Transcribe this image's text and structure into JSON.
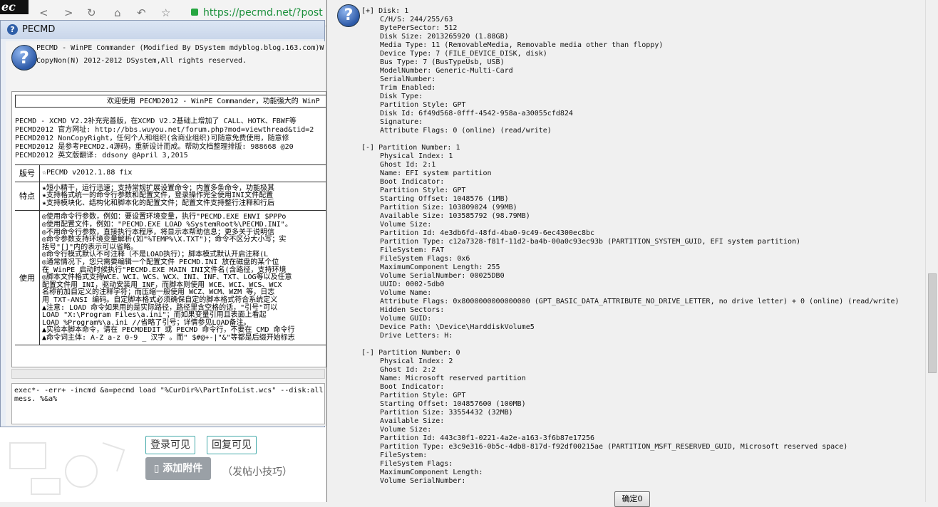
{
  "browser": {
    "url": "https://pecmd.net/?post",
    "logo_text": "ec"
  },
  "pecmd": {
    "title": "PECMD",
    "header_line1": "PECMD - WinPE Commander (Modified By DSystem mdyblog.blog.163.com)W",
    "header_line2": "CopyNon(N) 2012-2012 DSystem,All rights reserved.",
    "banner": "欢迎使用 PECMD2012 - WinPE Commander，功能强大的 WinP",
    "intro_lines": [
      "PECMD - XCMD V2.2补充完善版，在XCMD V2.2基础上增加了 CALL、HOTK、FBWF等",
      "PECMD2012 官方网址: http://bbs.wuyou.net/forum.php?mod=viewthread&tid=2",
      "PECMD2012 NonCopyRight，任何个人和组织(含商业组织)可随意免费使用，随意修",
      "PECMD2012 是参考PECMD2.4源码，重新设计而成。帮助文档整理排版: 988668 @20",
      "PECMD2012 英文版翻译: ddsony @April 3,2015"
    ],
    "table": [
      {
        "key": "版号",
        "lines": [
          "☆PECMD v2012.1.88      fix"
        ]
      },
      {
        "key": "特点",
        "lines": [
          "★短小精干，运行迅速；支持常规扩展设置命令；内置多条命令，功能极其",
          "★支持格式统一的命令行参数和配置文件，登录操作完全使用INI文件配置",
          "★支持模块化、结构化和脚本化的配置文件；配置文件支持整行注释和行后"
        ]
      },
      {
        "key": "使用",
        "lines": [
          "◎使用命令行参数，例如：要设置环境变量，执行\"PECMD.EXE ENVI $PPPo",
          "◎使用配置文件，例如：\"PECMD.EXE LOAD %SystemRoot%\\PECMD.INI\"。",
          "◎不用命令行参数，直接执行本程序，将显示本帮助信息；更多关于说明信",
          "◎命令参数支持环境变量解析(如\"%TEMP%\\X.TXT\")；命令不区分大小写；实",
          "  括号\"[]\"内的表示可以省略。",
          "◎命令行模式默认不可注释（不是LOAD执行）；脚本模式默认开启注释(L",
          "◎通常情况下，您只需要编辑一个配置文件 PECMD.INI 放在磁盘的某个位",
          "  在 WinPE 启动时候执行\"PECMD.EXE MAIN INI文件名(含路径，支持环境",
          "◎脚本文件格式支持WCE、WCI、WCS、WCX、INI、INF、TXT、LOG等以及任意",
          "  配置文件用 INI，驱动安装用 INF，而脚本则使用 WCE、WCI、WCS、WCX",
          "  名称前加自定义的注释字符；而压缩一般使用 WCZ、WCM、WZM 等，日志",
          "  用 TXT-ANSI 编码。自定脚本格式必须确保自定的脚本格式符合系统定义",
          "▲注意: LOAD 命令如果用的是实际路径，路径里含空格的话，\"引号\"可以",
          "        LOAD \"X:\\Program Files\\a.ini\"；而如果变量引用且表面上看起",
          "        LOAD %Program%\\a.ini //省略了引号；详情参见LOAD备注。",
          "▲实验本脚本命令，请在 PECMDEDIT 或 PECMD 命令行，不要在 CMD 命令行",
          "▲命令词主体:  A-Z a-z 0-9 _ 汉字 。而\" $#@+-|\"&\"等都是后缀开始标志"
        ]
      }
    ],
    "command_text": "exec*- -err+ -incmd &a=pecmd load \"%CurDir%\\PartInfoList.wcs\" --disk:all\nmess. %&a%"
  },
  "web": {
    "login_visible": "登录可见",
    "reply_visible": "回复可见",
    "add_attachment": "添加附件",
    "tips": "（发帖小技巧）"
  },
  "info": {
    "disk": {
      "toggle": "[+]",
      "head": "Disk: 1",
      "lines": [
        "C/H/S: 244/255/63",
        "BytePerSector: 512",
        "Disk Size: 2013265920 (1.88GB)",
        "Media Type: 11 (RemovableMedia, Removable media other than floppy)",
        "Device Type: 7 (FILE_DEVICE_DISK, disk)",
        "Bus Type: 7 (BusTypeUsb, USB)",
        "ModelNumber: Generic-Multi-Card",
        "SerialNumber:",
        "Trim Enabled:",
        "Disk Type:",
        "Partition Style: GPT",
        "Disk Id: 6f49d568-0fff-4542-958a-a30055cfd824",
        "Signature:",
        "Attribute Flags: 0 (online) (read/write)"
      ]
    },
    "partitions": [
      {
        "toggle": "[-]",
        "head": "Partition Number: 1",
        "lines": [
          "Physical Index: 1",
          "Ghost Id: 2:1",
          "Name: EFI system partition",
          "Boot Indicator:",
          "Partition Style: GPT",
          "Starting Offset: 1048576 (1MB)",
          "Partition Size: 103809024 (99MB)",
          "Available Size: 103585792 (98.79MB)",
          "Volume Size:",
          "Partition Id: 4e3db6fd-48fd-4ba0-9c49-6ec4300ec8bc",
          "Partition Type: c12a7328-f81f-11d2-ba4b-00a0c93ec93b (PARTITION_SYSTEM_GUID, EFI system partition)",
          "FileSystem: FAT",
          "FileSystem Flags: 0x6",
          "MaximumComponent Length: 255",
          "Volume SerialNumber: 00025DB0",
          "UUID: 0002-5db0",
          "Volume Name:",
          "Attribute Flags: 0x8000000000000000 (GPT_BASIC_DATA_ATTRIBUTE_NO_DRIVE_LETTER, no drive letter) + 0 (online) (read/write)",
          "Hidden Sectors:",
          "Volume GUID:",
          "Device Path: \\Device\\HarddiskVolume5",
          "Drive Letters: H:"
        ]
      },
      {
        "toggle": "[-]",
        "head": "Partition Number: 0",
        "lines": [
          "Physical Index: 2",
          "Ghost Id: 2:2",
          "Name: Microsoft reserved partition",
          "Boot Indicator:",
          "Partition Style: GPT",
          "Starting Offset: 104857600 (100MB)",
          "Partition Size: 33554432 (32MB)",
          "Available Size:",
          "Volume Size:",
          "Partition Id: 443c30f1-0221-4a2e-a163-3f6b87e17256",
          "Partition Type: e3c9e316-0b5c-4db8-817d-f92df00215ae (PARTITION_MSFT_RESERVED_GUID, Microsoft reserved space)",
          "FileSystem:",
          "FileSystem Flags:",
          "MaximumComponent Length:",
          "Volume SerialNumber:"
        ]
      }
    ],
    "ok_button": "确定0"
  }
}
